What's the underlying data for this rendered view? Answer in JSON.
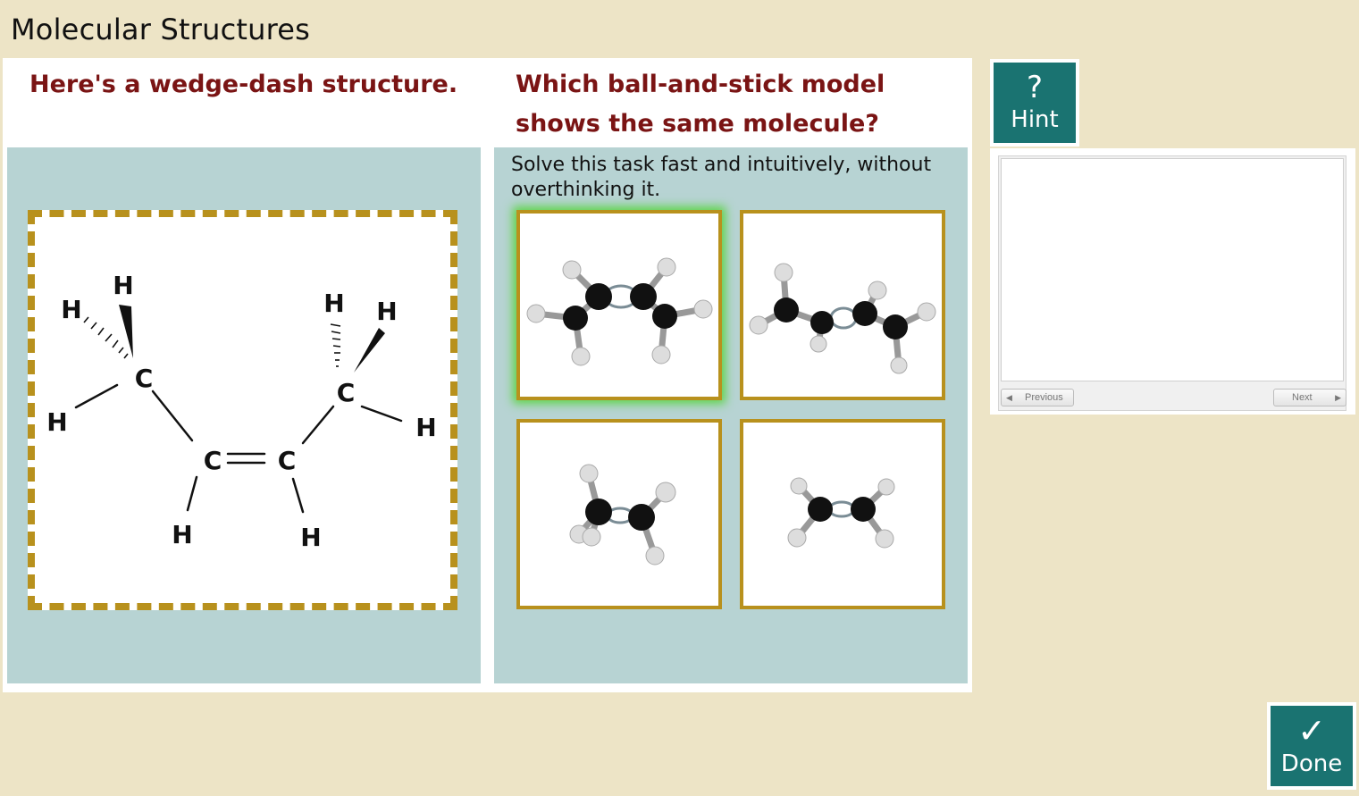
{
  "page_title": "Molecular Structures",
  "prompt_left": "Here's a wedge-dash structure.",
  "prompt_right": "Which ball-and-stick model shows the same molecule?",
  "instruction": "Solve this task fast and intuitively, without overthinking it.",
  "structure": {
    "atoms": {
      "c": "C",
      "h": "H"
    }
  },
  "choices": [
    {
      "name": "choice-1",
      "selected": true
    },
    {
      "name": "choice-2",
      "selected": false
    },
    {
      "name": "choice-3",
      "selected": false
    },
    {
      "name": "choice-4",
      "selected": false
    }
  ],
  "hint": {
    "icon": "?",
    "label": "Hint",
    "previous": "Previous",
    "next": "Next"
  },
  "done": {
    "icon": "✓",
    "label": "Done"
  },
  "colors": {
    "background": "#ede4c6",
    "prompt_text": "#7a1414",
    "panel": "#b7d3d3",
    "frame": "#b8911d",
    "button": "#1a7371",
    "selected_glow": "#5fd44a"
  }
}
